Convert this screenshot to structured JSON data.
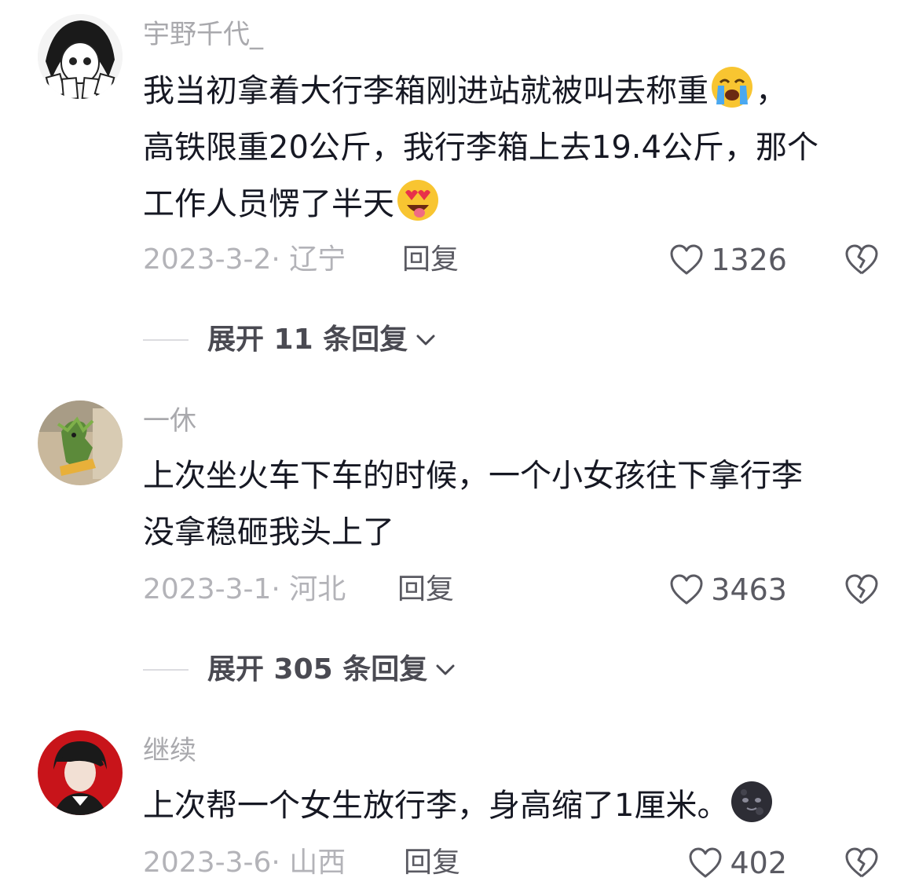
{
  "comments": [
    {
      "username": "宇野千代_",
      "line1": "我当初拿着大行李箱刚进站就被叫去称重",
      "line1_after": "，",
      "line2": "高铁限重20公斤，我行李箱上去19.4公斤，那个",
      "line3": "工作人员愣了半天",
      "date": "2023-3-2· 辽宁",
      "reply_label": "回复",
      "likes": "1326",
      "expand_label": "展开 11 条回复",
      "emoji1": "loudly-crying-face-icon",
      "emoji2": "star-struck-face-icon"
    },
    {
      "username": "一休",
      "line1": "上次坐火车下车的时候，一个小女孩往下拿行李",
      "line2": "没拿稳砸我头上了",
      "date": "2023-3-1· 河北",
      "reply_label": "回复",
      "likes": "3463",
      "expand_label": "展开 305 条回复"
    },
    {
      "username": "继续",
      "line1": "上次帮一个女生放行李，身高缩了1厘米。",
      "date": "2023-3-6· 山西",
      "reply_label": "回复",
      "likes": "402",
      "emoji1": "new-moon-face-icon"
    }
  ],
  "colors": {
    "background": "#ffffff",
    "text_primary": "#161823",
    "text_secondary": "#a9a9ad"
  }
}
